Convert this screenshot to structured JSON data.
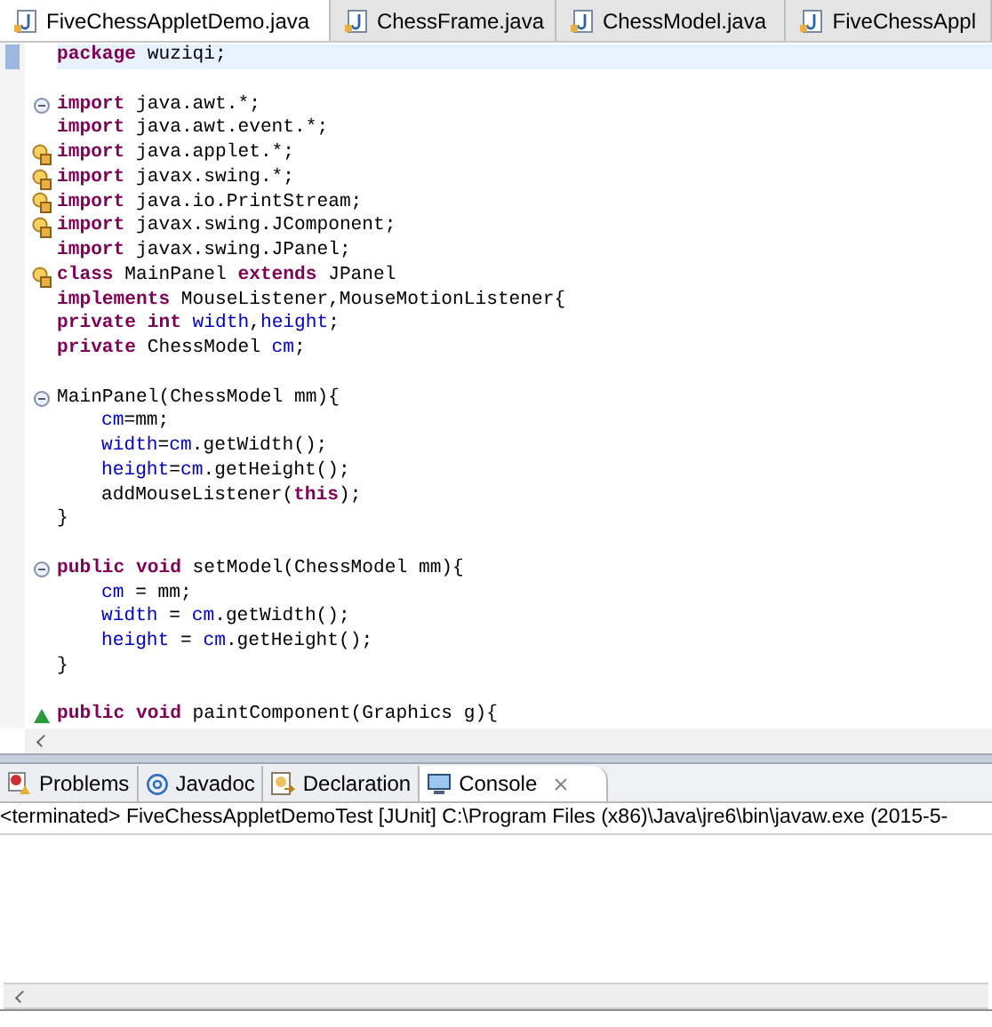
{
  "editor_tabs": [
    {
      "label": "FiveChessAppletDemo.java",
      "selected": true
    },
    {
      "label": "ChessFrame.java",
      "selected": false
    },
    {
      "label": "ChessModel.java",
      "selected": false
    },
    {
      "label": "FiveChessAppl",
      "selected": false
    }
  ],
  "code_lines": [
    {
      "kind": "plain",
      "blank_before": false,
      "current": true,
      "tokens": [
        {
          "kind": "keyword",
          "text": "package"
        },
        {
          "kind": "plain",
          "text": " wuziqi;"
        }
      ]
    },
    {
      "kind": "fold",
      "blank_before": true,
      "current": false,
      "tokens": [
        {
          "kind": "keyword",
          "text": "import"
        },
        {
          "kind": "plain",
          "text": " java.awt.*;"
        }
      ]
    },
    {
      "kind": "plain",
      "blank_before": false,
      "current": false,
      "tokens": [
        {
          "kind": "keyword",
          "text": "import"
        },
        {
          "kind": "plain",
          "text": " java.awt.event.*;"
        }
      ]
    },
    {
      "kind": "warning",
      "blank_before": false,
      "current": false,
      "tokens": [
        {
          "kind": "keyword",
          "text": "import"
        },
        {
          "kind": "plain",
          "text": " java.applet.*;"
        }
      ]
    },
    {
      "kind": "warning",
      "blank_before": false,
      "current": false,
      "tokens": [
        {
          "kind": "keyword",
          "text": "import"
        },
        {
          "kind": "plain",
          "text": " javax.swing.*;"
        }
      ]
    },
    {
      "kind": "warning",
      "blank_before": false,
      "current": false,
      "tokens": [
        {
          "kind": "keyword",
          "text": "import"
        },
        {
          "kind": "plain",
          "text": " java.io.PrintStream;"
        }
      ]
    },
    {
      "kind": "warning",
      "blank_before": false,
      "current": false,
      "tokens": [
        {
          "kind": "keyword",
          "text": "import"
        },
        {
          "kind": "plain",
          "text": " javax.swing.JComponent;"
        }
      ]
    },
    {
      "kind": "plain",
      "blank_before": false,
      "current": false,
      "tokens": [
        {
          "kind": "keyword",
          "text": "import"
        },
        {
          "kind": "plain",
          "text": " javax.swing.JPanel;"
        }
      ]
    },
    {
      "kind": "warning",
      "blank_before": false,
      "current": false,
      "tokens": [
        {
          "kind": "keyword",
          "text": "class"
        },
        {
          "kind": "plain",
          "text": " MainPanel"
        },
        {
          "kind": "keyword",
          "text": " extends"
        },
        {
          "kind": "plain",
          "text": " JPanel"
        }
      ]
    },
    {
      "kind": "plain",
      "blank_before": false,
      "current": false,
      "tokens": [
        {
          "kind": "keyword",
          "text": "implements"
        },
        {
          "kind": "plain",
          "text": " MouseListener,MouseMotionListener{"
        }
      ]
    },
    {
      "kind": "plain",
      "blank_before": false,
      "current": false,
      "tokens": [
        {
          "kind": "keyword",
          "text": "private"
        },
        {
          "kind": "keyword",
          "text": " int"
        },
        {
          "kind": "field",
          "text": " width"
        },
        {
          "kind": "plain",
          "text": ","
        },
        {
          "kind": "field",
          "text": "height"
        },
        {
          "kind": "plain",
          "text": ";"
        }
      ]
    },
    {
      "kind": "plain",
      "blank_before": false,
      "current": false,
      "tokens": [
        {
          "kind": "keyword",
          "text": "private"
        },
        {
          "kind": "plain",
          "text": " ChessModel"
        },
        {
          "kind": "field",
          "text": " cm"
        },
        {
          "kind": "plain",
          "text": ";"
        }
      ]
    },
    {
      "kind": "fold",
      "blank_before": true,
      "current": false,
      "tokens": [
        {
          "kind": "plain",
          "text": "MainPanel(ChessModel mm){"
        }
      ],
      "children": [
        {
          "blank_before": false,
          "current": false,
          "tokens": [
            {
              "kind": "field",
              "text": "cm"
            },
            {
              "kind": "plain",
              "text": "=mm;"
            }
          ]
        },
        {
          "blank_before": false,
          "current": false,
          "tokens": [
            {
              "kind": "field",
              "text": "width"
            },
            {
              "kind": "plain",
              "text": "="
            },
            {
              "kind": "field",
              "text": "cm"
            },
            {
              "kind": "plain",
              "text": ".getWidth();"
            }
          ]
        },
        {
          "blank_before": false,
          "current": false,
          "tokens": [
            {
              "kind": "field",
              "text": "height"
            },
            {
              "kind": "plain",
              "text": "="
            },
            {
              "kind": "field",
              "text": "cm"
            },
            {
              "kind": "plain",
              "text": ".getHeight();"
            }
          ]
        },
        {
          "blank_before": false,
          "current": false,
          "tokens": [
            {
              "kind": "plain",
              "text": "addMouseListener("
            },
            {
              "kind": "keyword",
              "text": "this"
            },
            {
              "kind": "plain",
              "text": ");"
            }
          ]
        }
      ]
    },
    {
      "kind": "plain",
      "blank_before": false,
      "current": false,
      "tokens": [
        {
          "kind": "plain",
          "text": "}"
        }
      ]
    },
    {
      "kind": "fold",
      "blank_before": true,
      "current": false,
      "tokens": [
        {
          "kind": "keyword",
          "text": "public"
        },
        {
          "kind": "keyword",
          "text": " void"
        },
        {
          "kind": "plain",
          "text": " setModel(ChessModel mm){"
        }
      ],
      "children": [
        {
          "blank_before": false,
          "current": false,
          "tokens": [
            {
              "kind": "field",
              "text": "cm"
            },
            {
              "kind": "plain",
              "text": " = mm;"
            }
          ]
        },
        {
          "blank_before": false,
          "current": false,
          "tokens": [
            {
              "kind": "field",
              "text": "width"
            },
            {
              "kind": "plain",
              "text": " ="
            },
            {
              "kind": "field",
              "text": " cm"
            },
            {
              "kind": "plain",
              "text": ".getWidth();"
            }
          ]
        },
        {
          "blank_before": false,
          "current": false,
          "tokens": [
            {
              "kind": "field",
              "text": "height"
            },
            {
              "kind": "plain",
              "text": " ="
            },
            {
              "kind": "field",
              "text": " cm"
            },
            {
              "kind": "plain",
              "text": ".getHeight();"
            }
          ]
        }
      ]
    },
    {
      "kind": "plain",
      "blank_before": false,
      "current": false,
      "tokens": [
        {
          "kind": "plain",
          "text": "}"
        }
      ]
    },
    {
      "kind": "override",
      "blank_before": true,
      "current": false,
      "tokens": [
        {
          "kind": "keyword",
          "text": "public"
        },
        {
          "kind": "keyword",
          "text": " void"
        },
        {
          "kind": "plain",
          "text": " paintComponent(Graphics g){"
        }
      ]
    }
  ],
  "bottom_tabs": [
    {
      "label": "Problems",
      "selected": false
    },
    {
      "label": "Javadoc",
      "selected": false
    },
    {
      "label": "Declaration",
      "selected": false
    },
    {
      "label": "Console",
      "selected": true
    }
  ],
  "console": {
    "status": "<terminated> FiveChessAppletDemoTest [JUnit] C:\\Program Files (x86)\\Java\\jre6\\bin\\javaw.exe (2015-5-"
  }
}
